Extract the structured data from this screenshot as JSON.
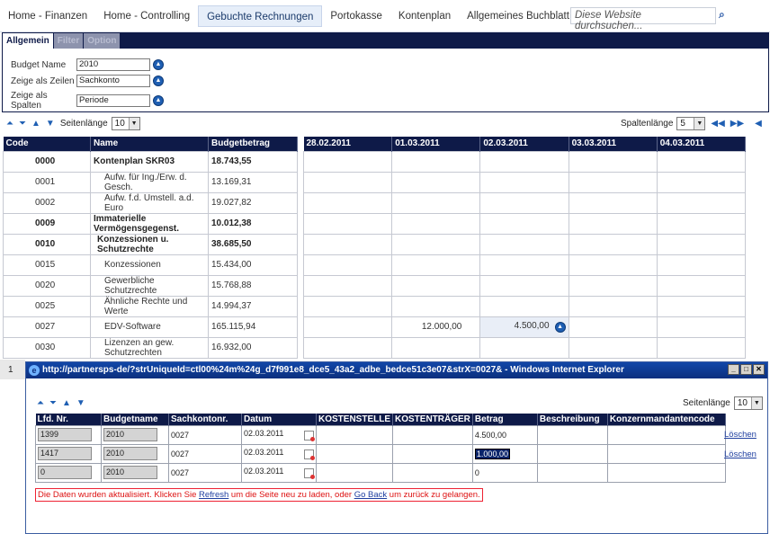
{
  "nav": {
    "tabs": [
      "Home - Finanzen",
      "Home - Controlling",
      "Gebuchte Rechnungen",
      "Portokasse",
      "Kontenplan",
      "Allgemeines Buchblatt"
    ],
    "search_placeholder": "Diese Website durchsuchen...",
    "search_button": "⌕"
  },
  "panel": {
    "tabs": [
      "Allgemein",
      "Filter",
      "Option"
    ],
    "fields": [
      {
        "label": "Budget Name",
        "value": "2010"
      },
      {
        "label": "Zeige als Zeilen",
        "value": "Sachkonto"
      },
      {
        "label": "Zeige als Spalten",
        "value": "Periode"
      }
    ]
  },
  "toolbar": {
    "page_length_label": "Seitenlänge",
    "page_length_value": "10",
    "column_length_label": "Spaltenlänge",
    "column_length_value": "5"
  },
  "budget_table": {
    "headers": [
      "Code",
      "Name",
      "Budgetbetrag"
    ],
    "rows": [
      {
        "code": "0000",
        "name": "Kontenplan SKR03",
        "amount": "18.743,55",
        "bold": true
      },
      {
        "code": "0001",
        "name": "Aufw. für Ing./Erw. d. Gesch.",
        "amount": "13.169,31",
        "bold": false
      },
      {
        "code": "0002",
        "name": "Aufw. f.d. Umstell. a.d. Euro",
        "amount": "19.027,82",
        "bold": false
      },
      {
        "code": "0009",
        "name": "Immaterielle Vermögensgegenst.",
        "amount": "10.012,38",
        "bold": true
      },
      {
        "code": "0010",
        "name": "Konzessionen u. Schutzrechte",
        "amount": "38.685,50",
        "bold": true
      },
      {
        "code": "0015",
        "name": "Konzessionen",
        "amount": "15.434,00",
        "bold": false
      },
      {
        "code": "0020",
        "name": "Gewerbliche Schutzrechte",
        "amount": "15.768,88",
        "bold": false
      },
      {
        "code": "0025",
        "name": "Ähnliche Rechte und Werte",
        "amount": "14.994,37",
        "bold": false
      },
      {
        "code": "0027",
        "name": "EDV-Software",
        "amount": "165.115,94",
        "bold": false
      },
      {
        "code": "0030",
        "name": "Lizenzen an gew. Schutzrechten",
        "amount": "16.932,00",
        "bold": false
      }
    ]
  },
  "date_table": {
    "headers": [
      "28.02.2011",
      "01.03.2011",
      "02.03.2011",
      "03.03.2011",
      "04.03.2011"
    ],
    "cell_0027_01": "12.000,00",
    "cell_0027_02": "4.500,00"
  },
  "pager": {
    "page": "1"
  },
  "popup": {
    "title": "http://partnersps-de/?strUniqueId=ctl00%24m%24g_d7f991e8_dce5_43a2_adbe_bedce51c3e07&strX=0027& - Windows Internet Explorer",
    "page_length_label": "Seitenlänge",
    "page_length_value": "10",
    "headers": [
      "Lfd. Nr.",
      "Budgetname",
      "Sachkontonr.",
      "Datum",
      "KOSTENSTELLE",
      "KOSTENTRÄGER",
      "Betrag",
      "Beschreibung",
      "Konzernmandantencode"
    ],
    "rows": [
      {
        "nr": "1399",
        "budget": "2010",
        "konto": "0027",
        "datum": "02.03.2011",
        "betrag": "4.500,00",
        "action": "Löschen"
      },
      {
        "nr": "1417",
        "budget": "2010",
        "konto": "0027",
        "datum": "02.03.2011",
        "betrag": "1.000,00",
        "action": "Löschen"
      },
      {
        "nr": "0",
        "budget": "2010",
        "konto": "0027",
        "datum": "02.03.2011",
        "betrag": "0",
        "action": ""
      }
    ],
    "message_before": "Die Daten wurden aktualisiert. Klicken Sie ",
    "message_refresh": "Refresh",
    "message_middle": " um die Seite neu zu laden, oder ",
    "message_goback": "Go Back",
    "message_after": " um zurück zu gelangen."
  }
}
